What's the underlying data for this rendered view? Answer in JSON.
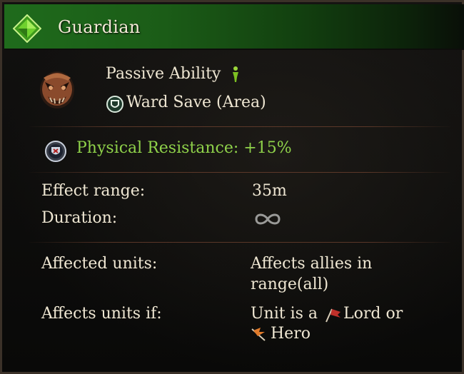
{
  "header": {
    "title": "Guardian",
    "gem_icon": "green-diamond-icon"
  },
  "ability": {
    "portrait_icon": "demon-mask-icon",
    "type_label": "Passive Ability",
    "type_icon": "passive-figure-icon",
    "name": "Ward Save (Area)",
    "name_icon": "ward-shield-icon"
  },
  "effect": {
    "icon": "resistance-shield-icon",
    "text": "Physical Resistance: +15%",
    "color": "#8fd24a"
  },
  "stats": {
    "effect_range_label": "Effect range:",
    "effect_range_value": "35m",
    "duration_label": "Duration:",
    "duration_value_icon": "infinity-icon"
  },
  "targets": {
    "affected_units_label": "Affected units:",
    "affected_units_line1": "Affects allies in",
    "affected_units_line2": "range(all)",
    "affects_if_label": "Affects units if:",
    "affects_if_prefix": "Unit is a",
    "lord_icon": "lord-banner-icon",
    "lord_text": "Lord or",
    "hero_icon": "hero-banner-icon",
    "hero_text": "Hero"
  }
}
